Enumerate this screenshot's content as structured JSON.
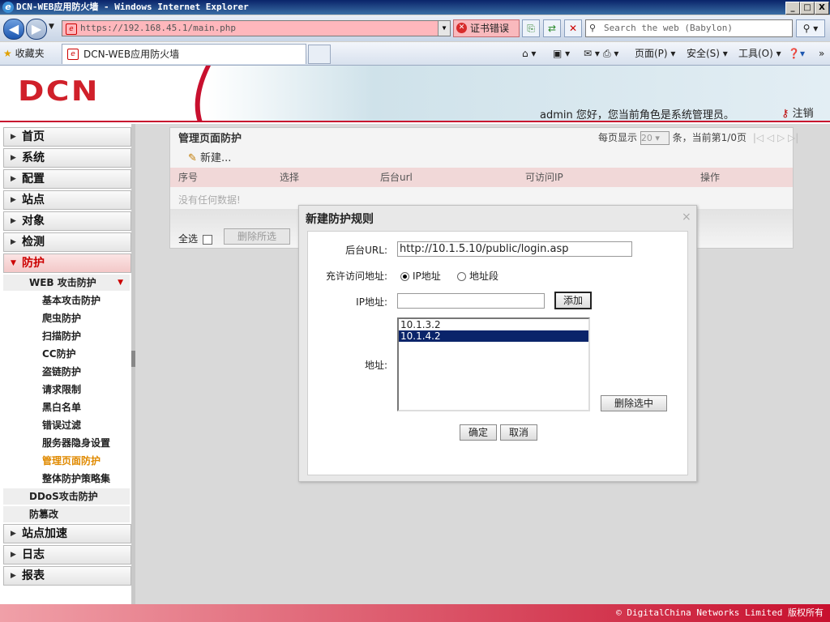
{
  "window": {
    "title": "DCN-WEB应用防火墙 - Windows Internet Explorer",
    "minimize": "_",
    "maximize": "□",
    "close": "X"
  },
  "browser": {
    "address": "https://192.168.45.1/main.php",
    "cert_error": "证书错误",
    "search_placeholder": "Search the web (Babylon)",
    "favorites": "收藏夹",
    "tab_title": "DCN-WEB应用防火墙",
    "commands": {
      "page": "页面(P)",
      "safety": "安全(S)",
      "tools": "工具(O)"
    }
  },
  "header": {
    "logo": "DCN",
    "user_info": "admin 您好，您当前角色是系统管理员。",
    "logout": "注销"
  },
  "sidebar": {
    "menus": [
      {
        "label": "首页"
      },
      {
        "label": "系统"
      },
      {
        "label": "配置"
      },
      {
        "label": "站点"
      },
      {
        "label": "对象"
      },
      {
        "label": "检测"
      },
      {
        "label": "防护"
      }
    ],
    "web_attack": "WEB 攻击防护",
    "web_items": [
      "基本攻击防护",
      "爬虫防护",
      "扫描防护",
      "CC防护",
      "盗链防护",
      "请求限制",
      "黑白名单",
      "错误过滤",
      "服务器隐身设置",
      "管理页面防护",
      "整体防护策略集"
    ],
    "ddos": "DDoS攻击防护",
    "tamper": "防篡改",
    "bottom_menus": [
      {
        "label": "站点加速"
      },
      {
        "label": "日志"
      },
      {
        "label": "报表"
      }
    ]
  },
  "panel": {
    "title": "管理页面防护",
    "per_page_prefix": "每页显示",
    "per_page_value": "20",
    "per_page_suffix": "条，当前第1/0页",
    "new_label": "新建...",
    "columns": [
      "序号",
      "选择",
      "后台url",
      "可访问IP",
      "操作"
    ],
    "no_data": "没有任何数据!",
    "select_all": "全选",
    "delete_selected": "删除所选"
  },
  "modal": {
    "title": "新建防护规则",
    "close": "×",
    "url_label": "后台URL:",
    "url_value": "http://10.1.5.10/public/login.asp",
    "allow_label": "充许访问地址:",
    "radio_ip": "IP地址",
    "radio_range": "地址段",
    "ip_label": "IP地址:",
    "ip_value": "",
    "add_label": "添加",
    "addr_label": "地址:",
    "addresses": [
      {
        "value": "10.1.3.2",
        "selected": false
      },
      {
        "value": "10.1.4.2",
        "selected": true
      }
    ],
    "delete_selected": "删除选中",
    "ok": "确定",
    "cancel": "取消"
  },
  "footer": {
    "copyright": "© DigitalChina Networks Limited 版权所有"
  },
  "colors": {
    "brand_red": "#c8102e",
    "accent_orange": "#e08a00",
    "selection": "#0a246a"
  }
}
